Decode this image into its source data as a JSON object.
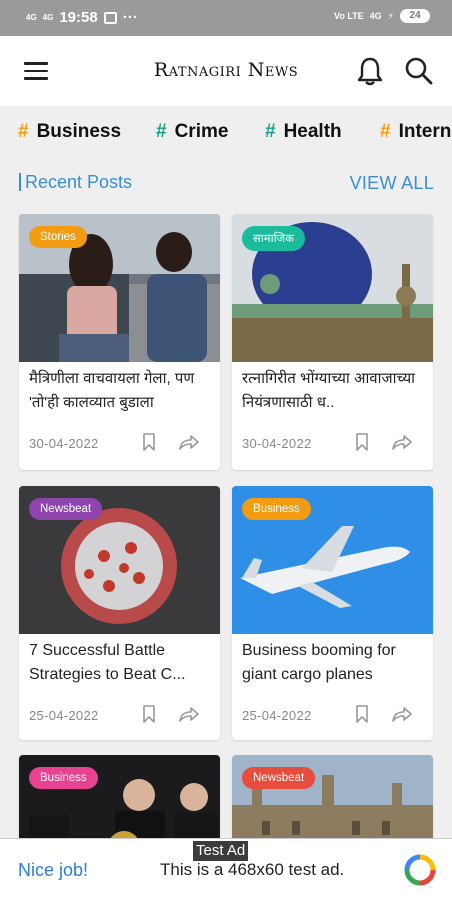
{
  "status_bar": {
    "time": "19:58",
    "signal_left_1": "4G",
    "signal_left_2": "4G",
    "more": "···",
    "volte": "Vo LTE",
    "signal_right": "4G",
    "battery": "24"
  },
  "app_bar": {
    "title": "Ratnagiri News"
  },
  "tags": [
    {
      "label": "Business",
      "color": "#f39c12"
    },
    {
      "label": "Crime",
      "color": "#16a085"
    },
    {
      "label": "Health",
      "color": "#16a085"
    },
    {
      "label": "Intern",
      "color": "#f39c12"
    }
  ],
  "section": {
    "title": "Recent Posts",
    "view_all": "VIEW ALL"
  },
  "posts": [
    {
      "badge": "Stories",
      "badge_color": "#f39c12",
      "title": "मैत्रिणीला वाचवायला गेला, पण 'तो'ही कालव्यात बुडाला",
      "date": "30-04-2022",
      "image": "two-young-people-photo"
    },
    {
      "badge": "सामाजिक",
      "badge_color": "#1abc9c",
      "title": "रत्नागिरीत भोंग्याच्या आवाजाच्या नियंत्रणासाठी ध..",
      "date": "30-04-2022",
      "image": "mosque-dome-photo"
    },
    {
      "badge": "Newsbeat",
      "badge_color": "#8e44ad",
      "title": "7 Successful Battle Strategies to Beat C...",
      "date": "25-04-2022",
      "image": "coronavirus-illustration"
    },
    {
      "badge": "Business",
      "badge_color": "#f39c12",
      "title": "Business booming for giant cargo planes",
      "date": "25-04-2022",
      "image": "airplane-sky-photo"
    },
    {
      "badge": "Business",
      "badge_color": "#e84393",
      "title": "",
      "date": "",
      "image": "award-ceremony-photo"
    },
    {
      "badge": "Newsbeat",
      "badge_color": "#e74c3c",
      "title": "",
      "date": "",
      "image": "university-building-photo"
    }
  ],
  "ad": {
    "label": "Test Ad",
    "headline": "Nice job!",
    "text": "This is a 468x60 test ad."
  }
}
